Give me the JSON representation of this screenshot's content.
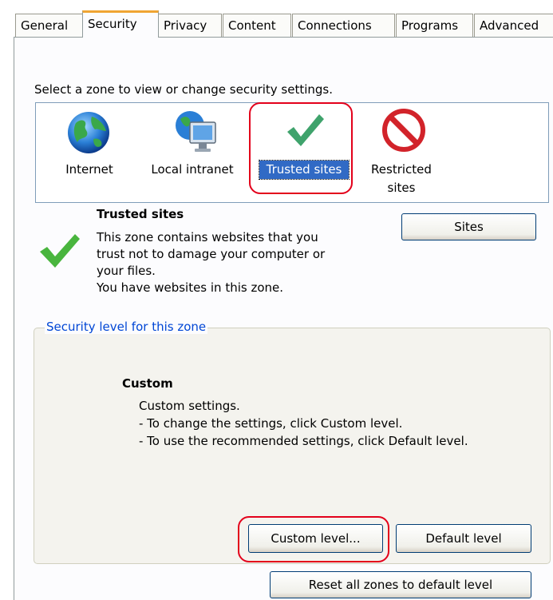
{
  "tabs": [
    {
      "label": "General"
    },
    {
      "label": "Security"
    },
    {
      "label": "Privacy"
    },
    {
      "label": "Content"
    },
    {
      "label": "Connections"
    },
    {
      "label": "Programs"
    },
    {
      "label": "Advanced"
    }
  ],
  "zones": {
    "prompt": "Select a zone to view or change security settings.",
    "items": [
      {
        "label": "Internet",
        "icon": "globe-icon"
      },
      {
        "label": "Local intranet",
        "icon": "intranet-icon"
      },
      {
        "label": "Trusted sites",
        "icon": "checkmark-icon"
      },
      {
        "label": "Restricted sites",
        "label_line1": "Restricted",
        "label_line2": "sites",
        "icon": "no-entry-icon"
      }
    ],
    "selected": "Trusted sites"
  },
  "zone_info": {
    "title": "Trusted sites",
    "description_lines": [
      "This zone contains websites that you",
      "trust not to damage your computer or",
      "your files.",
      "You have websites in this zone."
    ],
    "sites_button": "Sites"
  },
  "security_level": {
    "group_label": "Security level for this zone",
    "level_name": "Custom",
    "lines": [
      "Custom settings.",
      "- To change the settings, click Custom level.",
      "- To use the recommended settings, click Default level."
    ],
    "custom_button": "Custom level...",
    "default_button": "Default level"
  },
  "reset_button": "Reset all zones to default level",
  "colors": {
    "selection": "#316ac5",
    "group_label": "#0046d5",
    "highlight_outline": "#e3001b",
    "tab_accent": "#f0a534"
  }
}
